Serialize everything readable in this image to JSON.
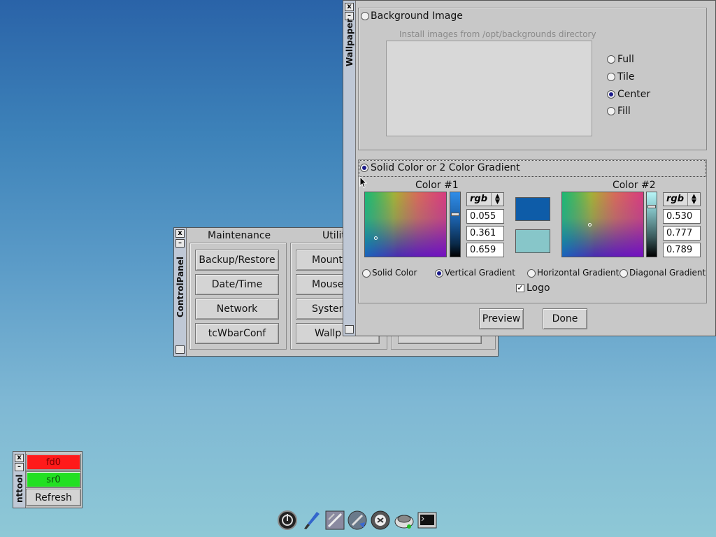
{
  "control_panel": {
    "title": "ControlPanel",
    "close": "x",
    "minimize": "–",
    "columns": [
      "Maintenance",
      "Utilit"
    ],
    "maintenance_buttons": [
      "Backup/Restore",
      "Date/Time",
      "Network",
      "tcWbarConf"
    ],
    "utility_buttons": [
      "Mount",
      "Mouse",
      "System",
      "Wallp"
    ]
  },
  "wallpaper": {
    "title": "Wallpaper",
    "close": "x",
    "minimize": "–",
    "background_image_label": "Background Image",
    "install_hint": "Install images from /opt/backgrounds directory",
    "placement_options": [
      {
        "label": "Full",
        "selected": false
      },
      {
        "label": "Tile",
        "selected": false
      },
      {
        "label": "Center",
        "selected": true
      },
      {
        "label": "Fill",
        "selected": false
      }
    ],
    "solid_label": "Solid Color or 2 Color Gradient",
    "color1": {
      "label": "Color #1",
      "mode": "rgb",
      "values": [
        "0.055",
        "0.361",
        "0.659"
      ],
      "swatch": "#0e5ca8"
    },
    "color2": {
      "label": "Color #2",
      "mode": "rgb",
      "values": [
        "0.530",
        "0.777",
        "0.789"
      ],
      "swatch": "#87c6c9"
    },
    "gradient_options": [
      {
        "label": "Solid Color",
        "selected": false
      },
      {
        "label": "Vertical Gradient",
        "selected": true
      },
      {
        "label": "Horizontal Gradient",
        "selected": false
      },
      {
        "label": "Diagonal Gradient",
        "selected": false
      }
    ],
    "logo_label": "Logo",
    "logo_checked": true,
    "preview_button": "Preview",
    "done_button": "Done"
  },
  "mnttool": {
    "title": "nttool",
    "close": "x",
    "minimize": "–",
    "drives": [
      {
        "label": "fd0",
        "color": "#ff1a1a"
      },
      {
        "label": "sr0",
        "color": "#22e022"
      }
    ],
    "refresh": "Refresh"
  },
  "taskbar": {
    "icons": [
      "power-icon",
      "paintbrush-icon",
      "control-panel-icon",
      "mount-icon",
      "apps-icon",
      "settings-icon",
      "terminal-icon"
    ]
  }
}
